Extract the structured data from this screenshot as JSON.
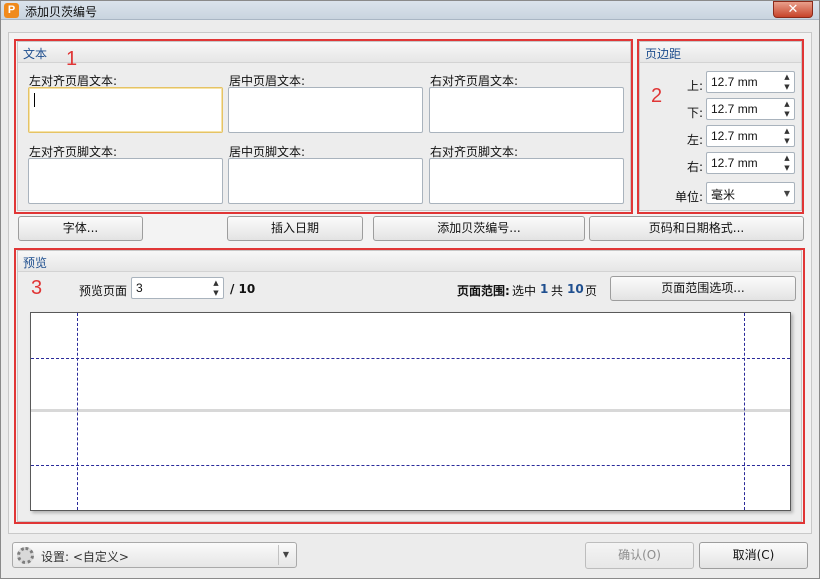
{
  "window": {
    "title": "添加贝茨编号",
    "close": "✕"
  },
  "text_group": {
    "title": "文本",
    "header_left_label": "左对齐页眉文本:",
    "header_center_label": "居中页眉文本:",
    "header_right_label": "右对齐页眉文本:",
    "footer_left_label": "左对齐页脚文本:",
    "footer_center_label": "居中页脚文本:",
    "footer_right_label": "右对齐页脚文本:"
  },
  "margin_group": {
    "title": "页边距",
    "top_label": "上:",
    "top_value": "12.7 mm",
    "bottom_label": "下:",
    "bottom_value": "12.7 mm",
    "left_label": "左:",
    "left_value": "12.7 mm",
    "right_label": "右:",
    "right_value": "12.7 mm",
    "unit_label": "单位:",
    "unit_value": "毫米"
  },
  "buttons": {
    "font": "字体...",
    "insert_date": "插入日期",
    "add_bates": "添加贝茨编号...",
    "page_date_format": "页码和日期格式..."
  },
  "preview_group": {
    "title": "预览",
    "preview_page_label": "预览页面",
    "preview_page_value": "3",
    "total_pages": "/ 10",
    "range_label": "页面范围:",
    "range_selected": "选中",
    "range_num": "1",
    "range_total_prefix": "共",
    "range_total": "10",
    "range_unit": "页",
    "range_options_button": "页面范围选项..."
  },
  "annotations": {
    "box1": "1",
    "box2": "2",
    "box3": "3"
  },
  "footer": {
    "settings_value": "设置: <自定义>",
    "ok_button": "确认(O)",
    "cancel_button": "取消(C)"
  },
  "colors": {
    "annotation_red": "#e03636",
    "group_title_blue": "#1f4f8f",
    "guide_blue": "#2a2a9a"
  },
  "icons": [
    "app-icon",
    "close-icon",
    "spin-up-icon",
    "spin-down-icon",
    "dropdown-arrow-icon",
    "gear-icon"
  ]
}
